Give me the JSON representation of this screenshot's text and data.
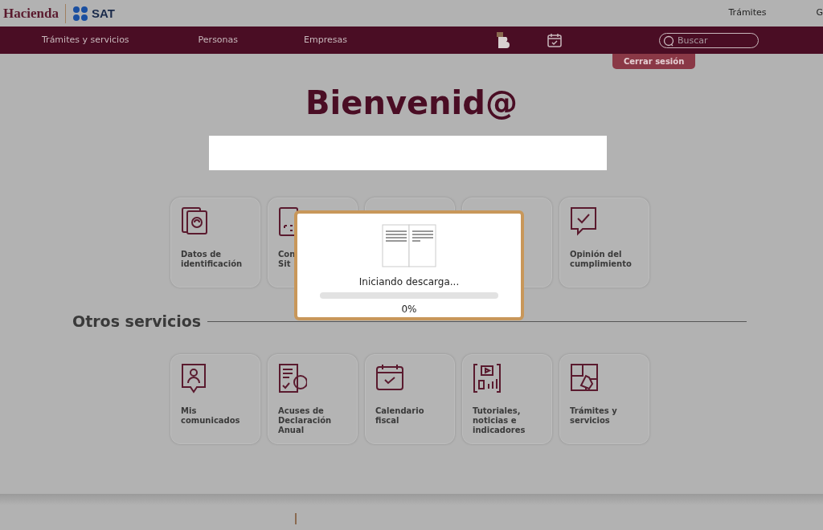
{
  "header": {
    "logo": "Hacienda",
    "sat_logo": "SAT",
    "links": [
      "Trámites",
      "G"
    ]
  },
  "navbar": {
    "items": [
      "Trámites y servicios",
      "Personas",
      "Empresas"
    ],
    "search": {
      "placeholder": "Buscar"
    }
  },
  "logout_button": "Cerrar sesión",
  "title": "Bienvenid@",
  "main_services": [
    {
      "kind": "tile",
      "lines": [
        "Datos de",
        "identificación"
      ]
    },
    {
      "kind": "tile",
      "lines": [
        "Con",
        "Sit"
      ]
    },
    {
      "kind": "tile"
    },
    {
      "kind": "tile"
    },
    {
      "kind": "tile",
      "lines": [
        "Opinión del",
        "cumplimiento"
      ]
    }
  ],
  "section_title": "Otros servicios",
  "other_services": [
    {
      "kind": "tile",
      "lines": [
        "Mis",
        "comunicados"
      ]
    },
    {
      "kind": "tile",
      "lines": [
        "Acuses de",
        "Declaración",
        "Anual"
      ]
    },
    {
      "kind": "tile",
      "lines": [
        "Calendario fiscal"
      ]
    },
    {
      "kind": "tile",
      "lines": [
        "Tutoriales,",
        "noticias e",
        "indicadores"
      ]
    },
    {
      "kind": "tile",
      "lines": [
        "Trámites y",
        "servicios"
      ]
    }
  ],
  "download_dialog": {
    "message": "Iniciando descarga...",
    "level": 0,
    "percent": "0%"
  }
}
